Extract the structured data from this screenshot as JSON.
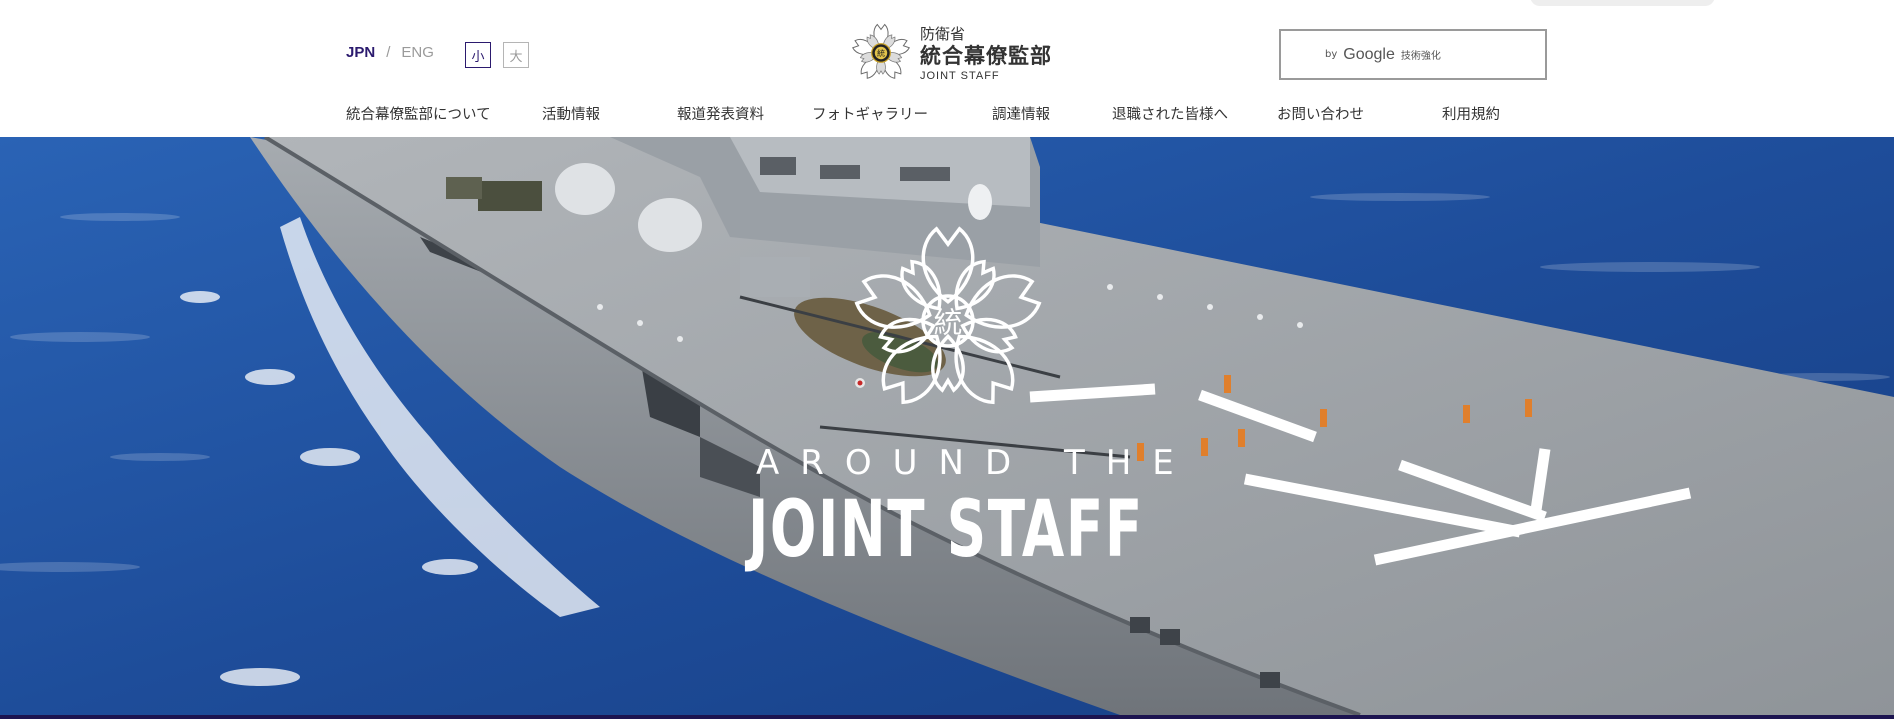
{
  "header": {
    "lang": {
      "jpn": "JPN",
      "separator": "/",
      "eng": "ENG"
    },
    "font_size": {
      "small": "小",
      "large": "大"
    },
    "logo": {
      "ministry": "防衛省",
      "name": "統合幕僚監部",
      "en": "JOINT STAFF",
      "emblem_char": "統"
    },
    "search": {
      "prefix": "by",
      "brand": "Google",
      "suffix": "技術強化"
    }
  },
  "nav": {
    "items": [
      "統合幕僚監部について",
      "活動情報",
      "報道発表資料",
      "フォトギャラリー",
      "調達情報",
      "退職された皆様へ",
      "お問い合わせ",
      "利用規約"
    ]
  },
  "hero": {
    "line1": "AROUND THE",
    "line2": "JOINT STAFF",
    "emblem_char": "統"
  },
  "colors": {
    "accent": "#2b1a6e",
    "sea": "#1f4e9c",
    "deck": "#9ea3a8",
    "hull": "#8e9399",
    "bottom_bar": "#1c1450"
  },
  "icons": {
    "header_emblem": "sakura-emblem-icon",
    "hero_emblem": "sakura-outline-emblem-icon"
  }
}
